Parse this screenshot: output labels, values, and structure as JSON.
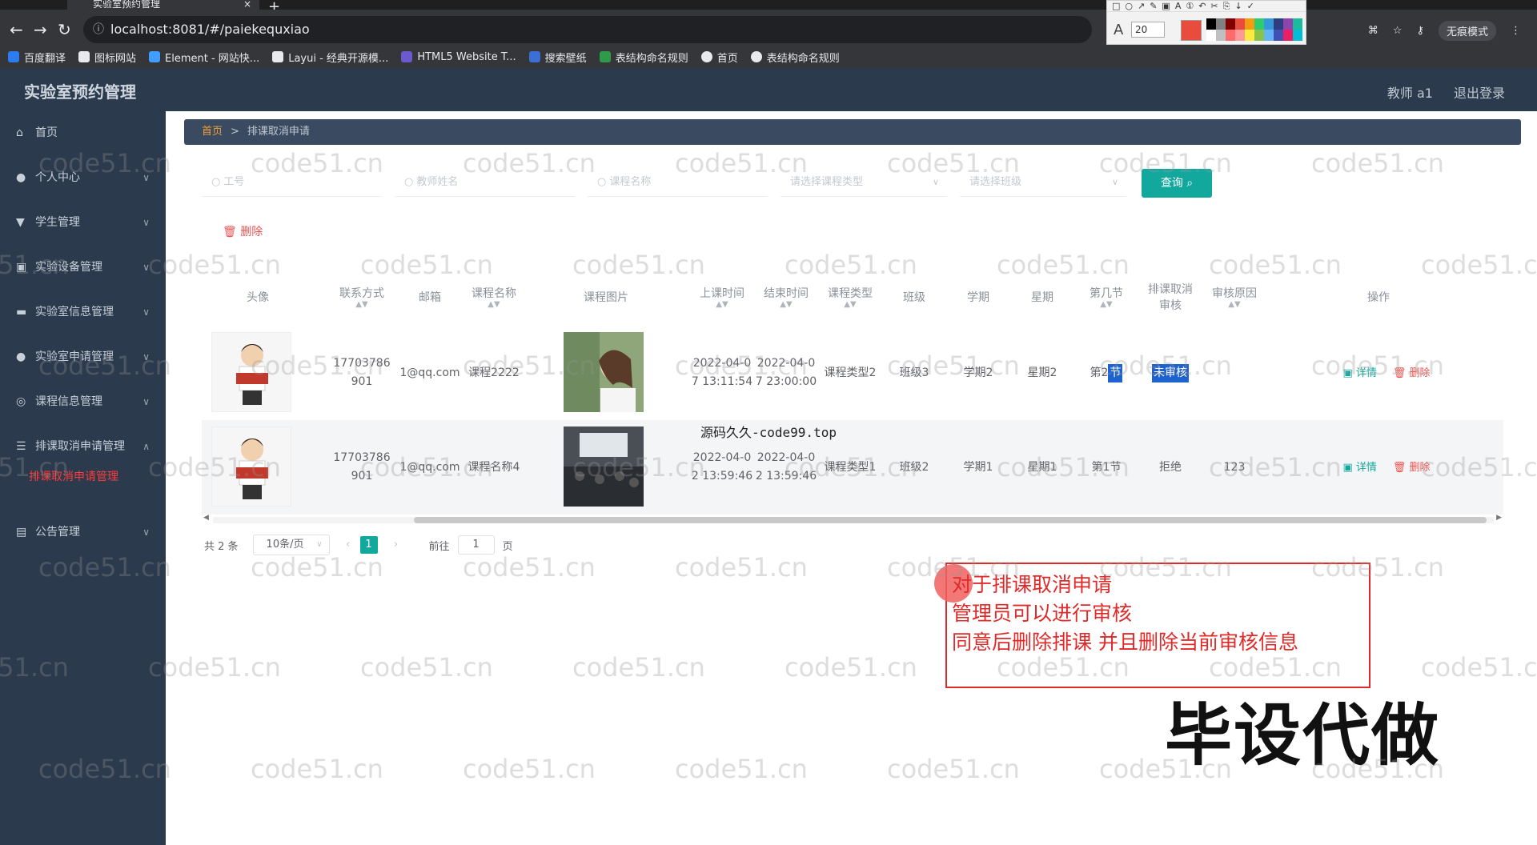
{
  "browser": {
    "tab_title": "实验室预约管理",
    "tab_close": "×",
    "new_tab": "+",
    "url": "localhost:8081/#/paiekequxiao",
    "incognito": "无痕模式",
    "bookmarks": [
      {
        "label": "百度翻译",
        "color": "#2d7bf0"
      },
      {
        "label": "图标网站",
        "color": "#e8eaed"
      },
      {
        "label": "Element - 网站快...",
        "color": "#409eff"
      },
      {
        "label": "Layui - 经典开源模...",
        "color": "#e8eaed"
      },
      {
        "label": "HTML5 Website T...",
        "color": "#6a5acd"
      },
      {
        "label": "搜索壁纸",
        "color": "#3b6fd6"
      },
      {
        "label": "表结构命名规则",
        "color": "#2e9b4b"
      },
      {
        "label": "首页",
        "color": "#e8eaed"
      },
      {
        "label": "表结构命名规则",
        "color": "#e8eaed"
      }
    ]
  },
  "snaptool": {
    "font_size": "20"
  },
  "header": {
    "brand": "实验室预约管理",
    "user": "教师 a1",
    "logout": "退出登录"
  },
  "sidebar": {
    "items": [
      {
        "label": "首页",
        "icon": "home-icon"
      },
      {
        "label": "个人中心",
        "icon": "user-icon"
      },
      {
        "label": "学生管理",
        "icon": "pin-icon"
      },
      {
        "label": "实验设备管理",
        "icon": "device-icon"
      },
      {
        "label": "实验室信息管理",
        "icon": "lab-icon"
      },
      {
        "label": "实验室申请管理",
        "icon": "user-icon"
      },
      {
        "label": "课程信息管理",
        "icon": "course-icon"
      },
      {
        "label": "排课取消申请管理",
        "icon": "list-icon"
      },
      {
        "label": "公告管理",
        "icon": "notice-icon"
      }
    ],
    "active_sub": "排课取消申请管理"
  },
  "breadcrumb": {
    "home": "首页",
    "sep": ">",
    "current": "排课取消申请"
  },
  "search": {
    "gonghao": "工号",
    "teacher": "教师姓名",
    "course": "课程名称",
    "course_type": "请选择课程类型",
    "class": "请选择班级",
    "query": "查询"
  },
  "toolbar": {
    "delete": "删除"
  },
  "table": {
    "headers": {
      "avatar": "头像",
      "phone": "联系方式",
      "email": "邮箱",
      "course": "课程名称",
      "photo": "课程图片",
      "start": "上课时间",
      "end": "结束时间",
      "type": "课程类型",
      "class": "班级",
      "term": "学期",
      "week": "星期",
      "section": "第几节",
      "audit_a": "排课取消",
      "audit_b": "审核",
      "reason": "审核原因",
      "op": "操作"
    },
    "rows": [
      {
        "phone": "17703786901",
        "email": "1@qq.com",
        "course": "课程2222",
        "start": "2022-04-07 13:11:54",
        "end": "2022-04-07 23:00:00",
        "type": "课程类型2",
        "class": "班级3",
        "term": "学期2",
        "week": "星期2",
        "section_a": "第2",
        "section_b": "节",
        "audit": "未审核",
        "reason": "",
        "detail": "详情",
        "del": "删除"
      },
      {
        "phone": "17703786901",
        "email": "1@qq.com",
        "course": "课程名称4",
        "start": "2022-04-02 13:59:46",
        "end": "2022-04-02 13:59:46",
        "type": "课程类型1",
        "class": "班级2",
        "term": "学期1",
        "week": "星期1",
        "section_a": "第1节",
        "section_b": "",
        "audit": "拒绝",
        "reason": "123",
        "detail": "详情",
        "del": "删除"
      }
    ],
    "overlay_caption": "源码久久-code99.top"
  },
  "pager": {
    "total": "共 2 条",
    "size": "10条/页",
    "prev": "‹",
    "page": "1",
    "next": "›",
    "goto": "前往",
    "goto_value": "1",
    "unit": "页"
  },
  "annotation": {
    "lines": [
      "对于排课取消申请",
      "管理员可以进行审核",
      "同意后删除排课 并且删除当前审核信息"
    ]
  },
  "big_text": "毕设代做",
  "watermark": "code51.cn",
  "colors": {
    "accent": "#13a89e",
    "sidebar": "#2b3a4d",
    "danger": "#ef5350",
    "annotation": "#e02a2a"
  }
}
